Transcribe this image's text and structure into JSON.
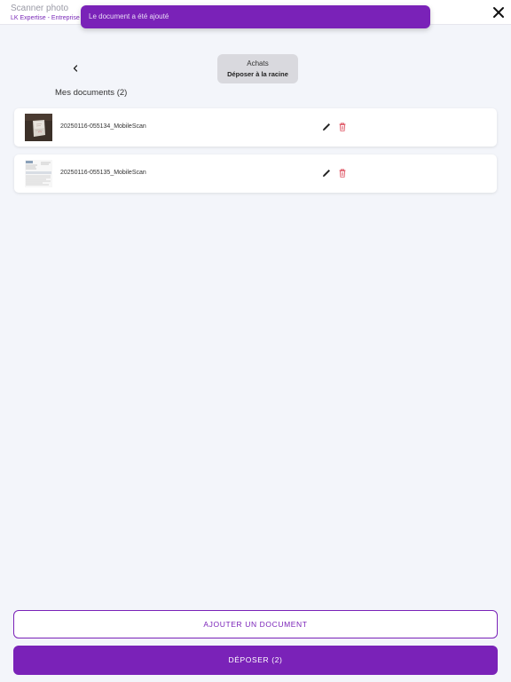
{
  "header": {
    "title": "Scanner photo",
    "subtitle": "LK Expertise - Entreprise"
  },
  "toast": {
    "message": "Le document a été ajouté"
  },
  "folder": {
    "name": "Achats",
    "action": "Déposer à la racine"
  },
  "documents_section": {
    "title": "Mes documents (2)"
  },
  "documents": [
    {
      "name": "20250116-055134_MobileScan",
      "thumbnail": "photo-of-receipt"
    },
    {
      "name": "20250116-055135_MobileScan",
      "thumbnail": "scanned-invoice"
    }
  ],
  "actions": {
    "add_document": "AJOUTER UN DOCUMENT",
    "submit": "DÉPOSER (2)"
  },
  "icons": {
    "close": "close-icon",
    "back": "chevron-left-icon",
    "edit": "pencil-icon",
    "delete": "trash-icon"
  },
  "colors": {
    "accent": "#7a22b8",
    "delete": "#e0606e",
    "background": "#f3f5fa"
  }
}
